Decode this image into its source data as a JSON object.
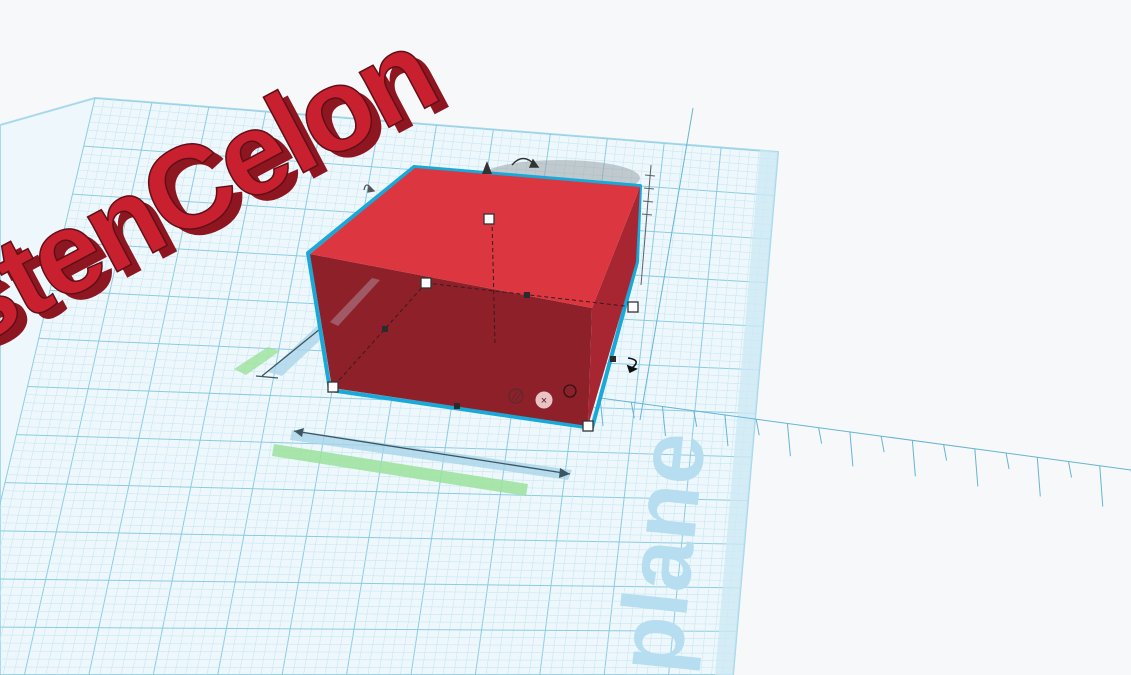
{
  "workplane": {
    "label": "plane",
    "color_grid_fine": "#c9e6f2",
    "color_grid_major": "#8ccbe2",
    "color_plane": "#eef8fc",
    "color_border": "#a9d9ec"
  },
  "text_object": {
    "text": "stenCelon",
    "color_face": "#c8202e",
    "color_side": "#8d1620"
  },
  "box_object": {
    "color_top": "#dc3640",
    "color_front": "#8e2029",
    "color_right": "#a82632",
    "selection_outline": "#19a9d8"
  },
  "dimension_guides": {
    "color_blue": "#a7d4ea",
    "color_green": "#9be29b"
  },
  "icons": {
    "rotate_handle_top": "rotate-arc-icon",
    "rotate_handle_right": "rotate-arrow-icon",
    "lift_handle": "lift-cone-icon",
    "delete_handle": "close-icon"
  }
}
